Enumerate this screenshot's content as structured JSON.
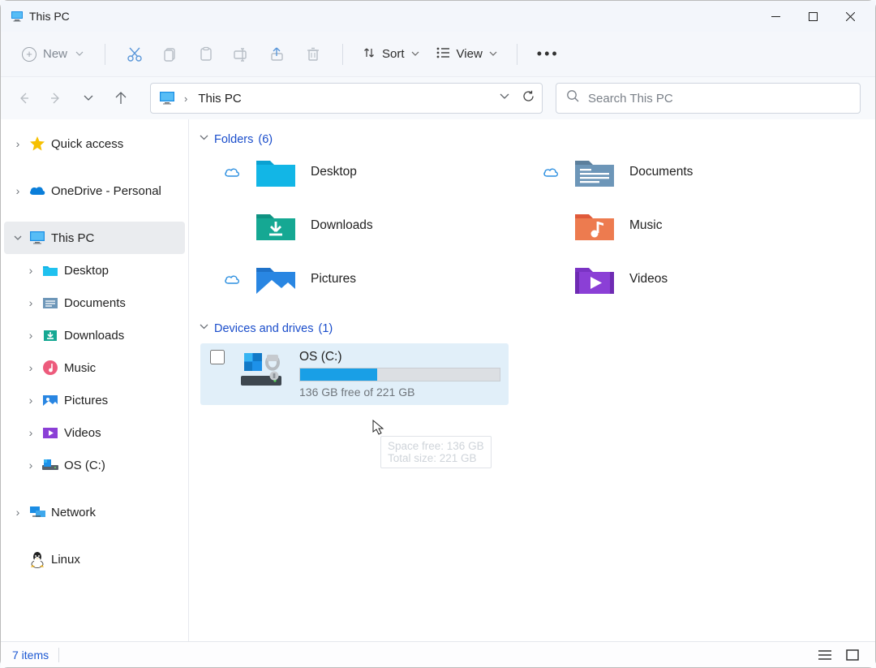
{
  "window": {
    "title": "This PC"
  },
  "toolbar": {
    "new_label": "New",
    "sort_label": "Sort",
    "view_label": "View"
  },
  "addressbar": {
    "crumb": "This PC"
  },
  "search": {
    "placeholder": "Search This PC"
  },
  "sidebar": {
    "quick_access": "Quick access",
    "onedrive": "OneDrive - Personal",
    "this_pc": "This PC",
    "desktop": "Desktop",
    "documents": "Documents",
    "downloads": "Downloads",
    "music": "Music",
    "pictures": "Pictures",
    "videos": "Videos",
    "os_c": "OS (C:)",
    "network": "Network",
    "linux": "Linux"
  },
  "sections": {
    "folders": {
      "label": "Folders",
      "count": "(6)"
    },
    "drives": {
      "label": "Devices and drives",
      "count": "(1)"
    }
  },
  "folders": {
    "desktop": "Desktop",
    "documents": "Documents",
    "downloads": "Downloads",
    "music": "Music",
    "pictures": "Pictures",
    "videos": "Videos"
  },
  "drive": {
    "name": "OS (C:)",
    "free_text": "136 GB free of 221 GB",
    "fill_pct": "38.5%"
  },
  "tooltip": {
    "line1": "Space free: 136 GB",
    "line2": "Total size: 221 GB"
  },
  "status": {
    "items": "7 items"
  }
}
